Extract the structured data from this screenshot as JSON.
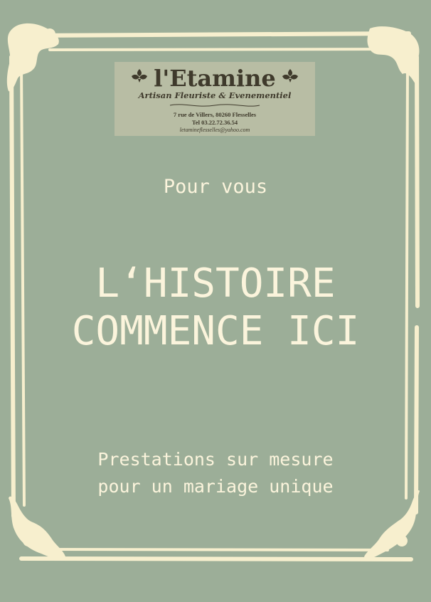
{
  "colors": {
    "background": "#9cae98",
    "frame": "#f7efce",
    "text": "#fbf4dc",
    "logo_panel": "#b8bda4",
    "logo_ink": "#3f3a2c"
  },
  "logo": {
    "name": "l'Etamine",
    "tagline": "Artisan Fleuriste & Evenementiel",
    "address": "7 rue de Villers, 80260 Flesselles",
    "phone": "Tel 03.22.72.36.54",
    "email": "letamineflesselles@yahoo.com",
    "ornament_icon": "fleuron-icon"
  },
  "intro": "Pour vous",
  "headline": {
    "line1": "L‘HISTOIRE",
    "line2": "COMMENCE ICI"
  },
  "tagline": {
    "line1": "Prestations sur mesure",
    "line2": "pour un mariage unique"
  }
}
